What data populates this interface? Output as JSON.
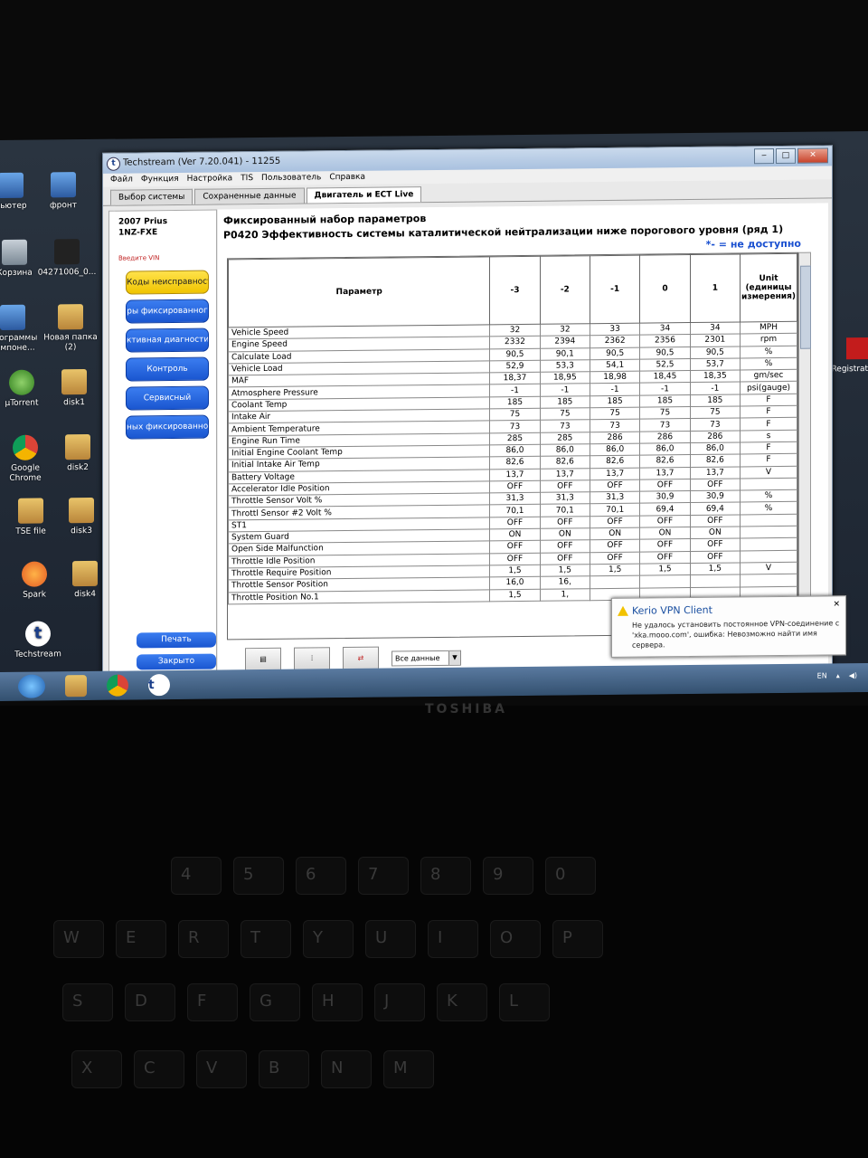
{
  "window": {
    "title": "Techstream (Ver 7.20.041) - 11255",
    "logo_letter": "t",
    "controls": {
      "minimize": "‒",
      "maximize": "□",
      "close": "✕"
    }
  },
  "menu": [
    "Файл",
    "Функция",
    "Настройка",
    "TIS",
    "Пользователь",
    "Справка"
  ],
  "tabs": [
    "Выбор системы",
    "Сохраненные данные",
    "Двигатель и ECT Live"
  ],
  "vehicle": {
    "model": "2007 Prius",
    "engine": "1NZ-FXE"
  },
  "vin_label": "Введите VIN",
  "nav_buttons": [
    "Коды неисправност",
    "ры фиксированног",
    "ктивная диагностик",
    "Контроль",
    "Сервисный",
    "ных фиксированног"
  ],
  "print_label": "Печать",
  "close_label": "Закрыто",
  "content": {
    "title": "Фиксированный набор параметров",
    "subtitle": "P0420 Эффективность системы каталитической нейтрализации ниже порогового уровня (ряд 1)",
    "na_note": "*- = не доступно"
  },
  "table": {
    "headers": [
      "Параметр",
      "-3",
      "-2",
      "-1",
      "0",
      "1",
      "Unit (единицы измерения)"
    ],
    "rows": [
      [
        "Vehicle Speed",
        "32",
        "32",
        "33",
        "34",
        "34",
        "MPH"
      ],
      [
        "Engine Speed",
        "2332",
        "2394",
        "2362",
        "2356",
        "2301",
        "rpm"
      ],
      [
        "Calculate Load",
        "90,5",
        "90,1",
        "90,5",
        "90,5",
        "90,5",
        "%"
      ],
      [
        "Vehicle Load",
        "52,9",
        "53,3",
        "54,1",
        "52,5",
        "53,7",
        "%"
      ],
      [
        "MAF",
        "18,37",
        "18,95",
        "18,98",
        "18,45",
        "18,35",
        "gm/sec"
      ],
      [
        "Atmosphere Pressure",
        "-1",
        "-1",
        "-1",
        "-1",
        "-1",
        "psi(gauge)"
      ],
      [
        "Coolant Temp",
        "185",
        "185",
        "185",
        "185",
        "185",
        "F"
      ],
      [
        "Intake Air",
        "75",
        "75",
        "75",
        "75",
        "75",
        "F"
      ],
      [
        "Ambient Temperature",
        "73",
        "73",
        "73",
        "73",
        "73",
        "F"
      ],
      [
        "Engine Run Time",
        "285",
        "285",
        "286",
        "286",
        "286",
        "s"
      ],
      [
        "Initial Engine Coolant Temp",
        "86,0",
        "86,0",
        "86,0",
        "86,0",
        "86,0",
        "F"
      ],
      [
        "Initial Intake Air Temp",
        "82,6",
        "82,6",
        "82,6",
        "82,6",
        "82,6",
        "F"
      ],
      [
        "Battery Voltage",
        "13,7",
        "13,7",
        "13,7",
        "13,7",
        "13,7",
        "V"
      ],
      [
        "Accelerator Idle Position",
        "OFF",
        "OFF",
        "OFF",
        "OFF",
        "OFF",
        ""
      ],
      [
        "Throttle Sensor Volt %",
        "31,3",
        "31,3",
        "31,3",
        "30,9",
        "30,9",
        "%"
      ],
      [
        "Throttl Sensor #2 Volt %",
        "70,1",
        "70,1",
        "70,1",
        "69,4",
        "69,4",
        "%"
      ],
      [
        "ST1",
        "OFF",
        "OFF",
        "OFF",
        "OFF",
        "OFF",
        ""
      ],
      [
        "System Guard",
        "ON",
        "ON",
        "ON",
        "ON",
        "ON",
        ""
      ],
      [
        "Open Side Malfunction",
        "OFF",
        "OFF",
        "OFF",
        "OFF",
        "OFF",
        ""
      ],
      [
        "Throttle Idle Position",
        "OFF",
        "OFF",
        "OFF",
        "OFF",
        "OFF",
        ""
      ],
      [
        "Throttle Require Position",
        "1,5",
        "1,5",
        "1,5",
        "1,5",
        "1,5",
        "V"
      ],
      [
        "Throttle Sensor Position",
        "16,0",
        "16,",
        "",
        "",
        "",
        ""
      ],
      [
        "Throttle Position No.1",
        "1,5",
        "1,",
        "",
        "",
        "",
        ""
      ]
    ]
  },
  "toolbar": {
    "dropdown_value": "Все данные"
  },
  "desktop_icons": [
    {
      "label": "пьютер"
    },
    {
      "label": "фронт"
    },
    {
      "label": "Корзина"
    },
    {
      "label": "04271006_0..."
    },
    {
      "label": "Программы компоне..."
    },
    {
      "label": "Новая папка (2)"
    },
    {
      "label": "µTorrent"
    },
    {
      "label": "disk1"
    },
    {
      "label": "Google Chrome"
    },
    {
      "label": "disk2"
    },
    {
      "label": "TSE file"
    },
    {
      "label": "disk3"
    },
    {
      "label": "Spark"
    },
    {
      "label": "disk4"
    },
    {
      "label": "Techstream"
    }
  ],
  "right_edge_label": "Registrat",
  "notification": {
    "title": "Kerio VPN Client",
    "body": "Не удалось установить постоянное VPN-соединение с 'xka.mooo.com', ошибка: Невозможно найти имя сервера."
  },
  "tray": {
    "lang": "EN"
  },
  "laptop_brand": "TOSHIBA",
  "keyboard": [
    "4",
    "5",
    "6",
    "7",
    "8",
    "9",
    "0",
    "W",
    "E",
    "R",
    "T",
    "Y",
    "U",
    "I",
    "O",
    "P",
    "S",
    "D",
    "F",
    "G",
    "H",
    "J",
    "K",
    "L",
    "X",
    "C",
    "V",
    "B",
    "N",
    "M"
  ]
}
